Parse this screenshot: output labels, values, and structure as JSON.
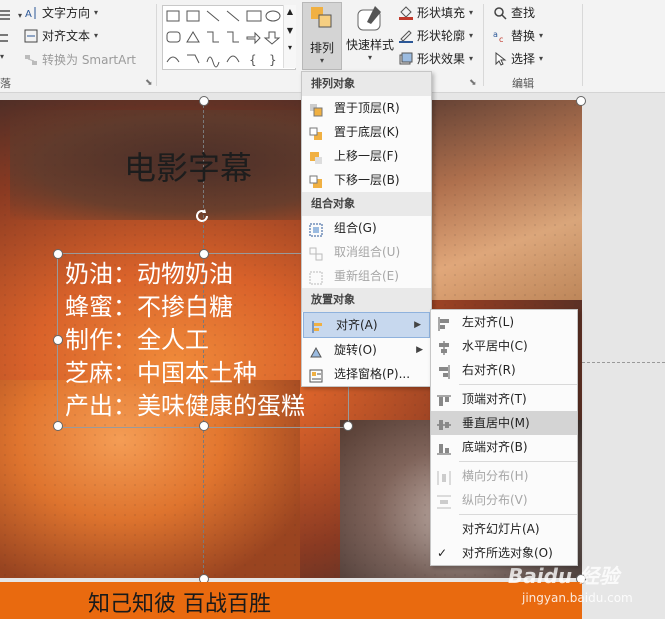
{
  "ribbon": {
    "paragraph": {
      "text_direction": "文字方向",
      "align_text": "对齐文本",
      "convert_smartart": "转换为 SmartArt",
      "group_label_fragment": "落"
    },
    "drawing": {
      "arrange": "排列",
      "quick_styles": "快速样式",
      "shape_fill": "形状填充",
      "shape_outline": "形状轮廓",
      "shape_effects": "形状效果"
    },
    "editing": {
      "find": "查找",
      "replace": "替换",
      "select": "选择",
      "group_label": "编辑"
    }
  },
  "arrange_menu": {
    "sections": [
      {
        "header": "排列对象",
        "items": [
          {
            "label": "置于顶层(R)",
            "enabled": true
          },
          {
            "label": "置于底层(K)",
            "enabled": true
          },
          {
            "label": "上移一层(F)",
            "enabled": true
          },
          {
            "label": "下移一层(B)",
            "enabled": true
          }
        ]
      },
      {
        "header": "组合对象",
        "items": [
          {
            "label": "组合(G)",
            "enabled": true
          },
          {
            "label": "取消组合(U)",
            "enabled": false
          },
          {
            "label": "重新组合(E)",
            "enabled": false
          }
        ]
      },
      {
        "header": "放置对象",
        "items": [
          {
            "label": "对齐(A)",
            "enabled": true
          },
          {
            "label": "旋转(O)",
            "enabled": true
          },
          {
            "label": "选择窗格(P)...",
            "enabled": true
          }
        ]
      }
    ]
  },
  "align_submenu": {
    "items": [
      {
        "label": "左对齐(L)",
        "enabled": true
      },
      {
        "label": "水平居中(C)",
        "enabled": true
      },
      {
        "label": "右对齐(R)",
        "enabled": true
      },
      {
        "label": "顶端对齐(T)",
        "enabled": true
      },
      {
        "label": "垂直居中(M)",
        "enabled": true
      },
      {
        "label": "底端对齐(B)",
        "enabled": true
      },
      {
        "label": "横向分布(H)",
        "enabled": false
      },
      {
        "label": "纵向分布(V)",
        "enabled": false
      },
      {
        "label": "对齐幻灯片(A)",
        "enabled": true
      },
      {
        "label": "对齐所选对象(O)",
        "enabled": true
      }
    ],
    "checked": "对齐所选对象(O)"
  },
  "slide": {
    "title": "电影字幕",
    "lines": [
      "奶油：动物奶油",
      "蜂蜜：不掺白糖",
      "制作：全人工",
      "芝麻：中国本土种",
      "产出：美味健康的蛋糕"
    ],
    "footer": "知己知彼 百战百胜"
  },
  "watermark": {
    "logo": "Baidu 经验",
    "url": "jingyan.baidu.com"
  },
  "colors": {
    "footer_bar": "#e96a0f",
    "menu_highlight": "#c7d8ee",
    "submenu_hover": "#d4d4d4"
  }
}
